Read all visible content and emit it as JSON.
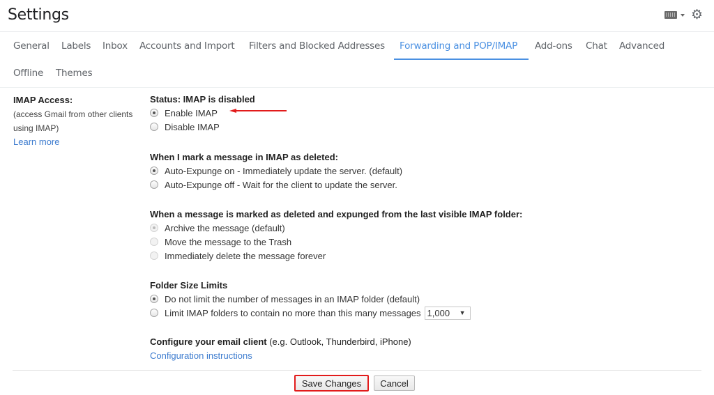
{
  "header": {
    "title": "Settings",
    "icons": [
      "keyboard-icon",
      "caret-down-icon",
      "gear-icon"
    ]
  },
  "tabs": [
    {
      "label": "General",
      "active": false
    },
    {
      "label": "Labels",
      "active": false
    },
    {
      "label": "Inbox",
      "active": false
    },
    {
      "label": "Accounts and Import",
      "active": false
    },
    {
      "label": "Filters and Blocked Addresses",
      "active": false
    },
    {
      "label": "Forwarding and POP/IMAP",
      "active": true
    },
    {
      "label": "Add-ons",
      "active": false
    },
    {
      "label": "Chat",
      "active": false
    },
    {
      "label": "Advanced",
      "active": false
    },
    {
      "label": "Offline",
      "active": false
    },
    {
      "label": "Themes",
      "active": false
    }
  ],
  "imap_access": {
    "label": "IMAP Access:",
    "description_line1": "(access Gmail from other clients",
    "description_line2": "using IMAP)",
    "learn_more": "Learn more"
  },
  "status": {
    "title": "Status: IMAP is disabled",
    "options": [
      {
        "label": "Enable IMAP",
        "checked": true
      },
      {
        "label": "Disable IMAP",
        "checked": false
      }
    ]
  },
  "deleted": {
    "title": "When I mark a message in IMAP as deleted:",
    "options": [
      {
        "label": "Auto-Expunge on - Immediately update the server. (default)",
        "checked": true
      },
      {
        "label": "Auto-Expunge off - Wait for the client to update the server.",
        "checked": false
      }
    ]
  },
  "expunged": {
    "title": "When a message is marked as deleted and expunged from the last visible IMAP folder:",
    "options": [
      {
        "label": "Archive the message (default)",
        "checked": true,
        "disabled": true
      },
      {
        "label": "Move the message to the Trash",
        "checked": false,
        "disabled": true
      },
      {
        "label": "Immediately delete the message forever",
        "checked": false,
        "disabled": true
      }
    ]
  },
  "folder_limits": {
    "title": "Folder Size Limits",
    "options": [
      {
        "label": "Do not limit the number of messages in an IMAP folder (default)",
        "checked": true
      },
      {
        "label": "Limit IMAP folders to contain no more than this many messages",
        "checked": false
      }
    ],
    "limit_select_value": "1,000"
  },
  "configure": {
    "title": "Configure your email client",
    "hint": " (e.g. Outlook, Thunderbird, iPhone)",
    "link": "Configuration instructions"
  },
  "footer": {
    "save_label": "Save Changes",
    "cancel_label": "Cancel"
  },
  "annotations": {
    "arrow_color": "#e21b1b",
    "highlight_color": "#e21b1b"
  },
  "colors": {
    "accent": "#4a90e2",
    "link": "#3d7ccf"
  }
}
